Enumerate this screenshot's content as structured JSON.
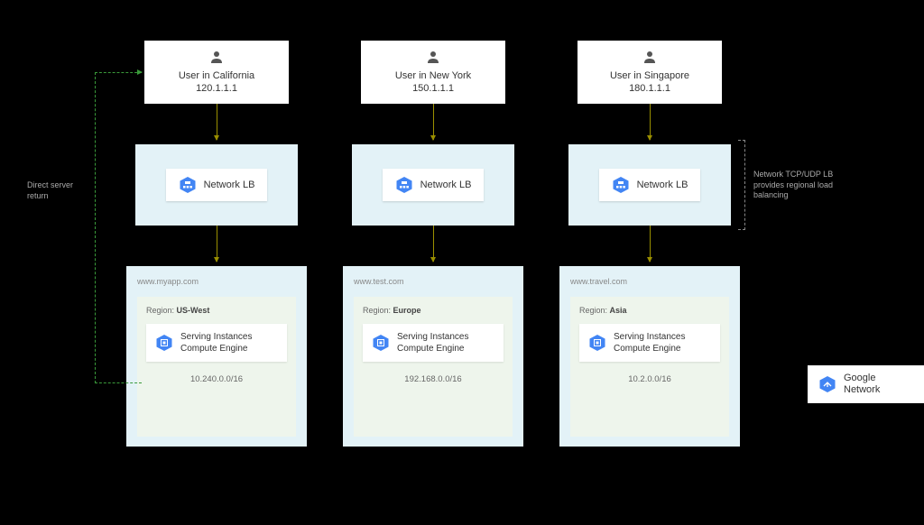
{
  "columns": [
    {
      "user_label": "User in California",
      "user_ip": "120.1.1.1",
      "lb_label": "Network LB",
      "domain": "www.myapp.com",
      "region_prefix": "Region:",
      "region": "US-West",
      "ce_line1": "Serving Instances",
      "ce_line2": "Compute Engine",
      "cidr": "10.240.0.0/16"
    },
    {
      "user_label": "User in New York",
      "user_ip": "150.1.1.1",
      "lb_label": "Network LB",
      "domain": "www.test.com",
      "region_prefix": "Region:",
      "region": "Europe",
      "ce_line1": "Serving Instances",
      "ce_line2": "Compute Engine",
      "cidr": "192.168.0.0/16"
    },
    {
      "user_label": "User in Singapore",
      "user_ip": "180.1.1.1",
      "lb_label": "Network LB",
      "domain": "www.travel.com",
      "region_prefix": "Region:",
      "region": "Asia",
      "ce_line1": "Serving Instances",
      "ce_line2": "Compute Engine",
      "cidr": "10.2.0.0/16"
    }
  ],
  "annotations": {
    "left": "Direct server return",
    "right": "Network TCP/UDP LB provides regional load balancing"
  },
  "legend": {
    "label": "Google Network"
  }
}
